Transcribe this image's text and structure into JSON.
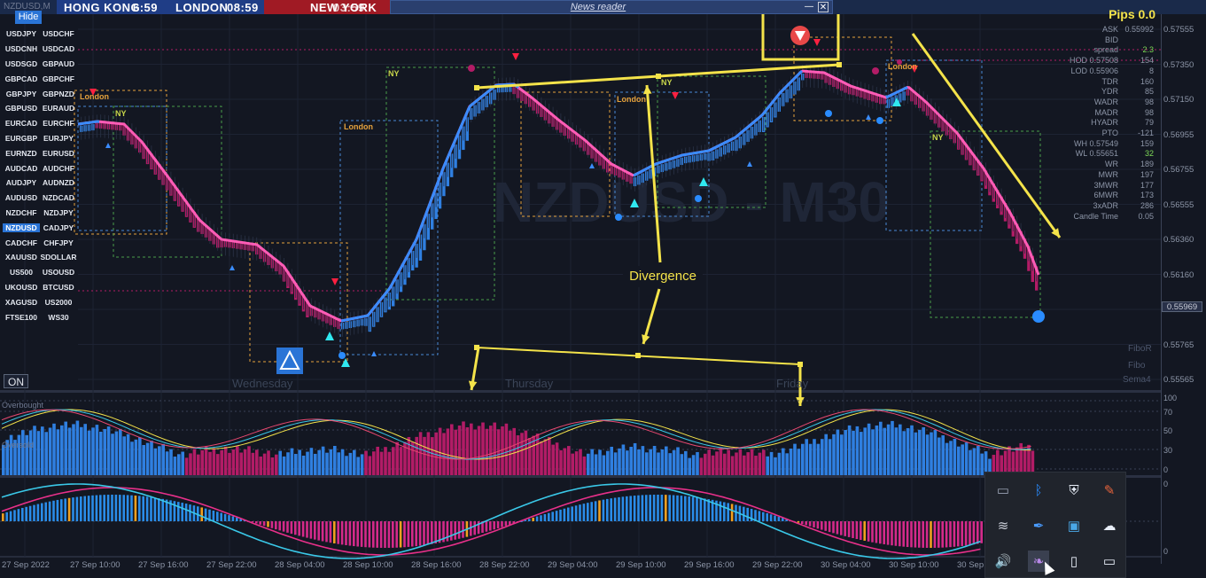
{
  "window": {
    "symbol_title": "NZDUSD,M",
    "hide_label": "Hide",
    "news_label": "News reader",
    "on_label": "ON",
    "watermark": "NZDUSD - M30"
  },
  "clocks": [
    {
      "label": "HONG KONG",
      "time": "6:59"
    },
    {
      "label": "LONDON",
      "time": "08:59"
    },
    {
      "label": "NEW YORK",
      "time": "03:59"
    }
  ],
  "symbols": [
    [
      "USDJPY",
      "USDCHF"
    ],
    [
      "USDCNH",
      "USDCAD"
    ],
    [
      "USDSGD",
      "GBPAUD"
    ],
    [
      "GBPCAD",
      "GBPCHF"
    ],
    [
      "GBPJPY",
      "GBPNZD"
    ],
    [
      "GBPUSD",
      "EURAUD"
    ],
    [
      "EURCAD",
      "EURCHF"
    ],
    [
      "EURGBP",
      "EURJPY"
    ],
    [
      "EURNZD",
      "EURUSD"
    ],
    [
      "AUDCAD",
      "AUDCHF"
    ],
    [
      "AUDJPY",
      "AUDNZD"
    ],
    [
      "AUDUSD",
      "NZDCAD"
    ],
    [
      "NZDCHF",
      "NZDJPY"
    ],
    [
      "NZDUSD",
      "CADJPY"
    ],
    [
      "CADCHF",
      "CHFJPY"
    ],
    [
      "XAUUSD",
      "SDOLLAR"
    ],
    [
      "US500",
      "USOUSD"
    ],
    [
      "UKOUSD",
      "BTCUSD"
    ],
    [
      "XAGUSD",
      "US2000"
    ],
    [
      "FTSE100",
      "WS30"
    ]
  ],
  "active_symbol": "NZDUSD",
  "stats": {
    "pips_title": "Pips 0.0",
    "rows": [
      {
        "label": "ASK",
        "value": "0.55992",
        "color": "#8d96a8"
      },
      {
        "label": "BID",
        "value": "",
        "color": "#8d96a8"
      },
      {
        "label": "spread",
        "value": "2.3",
        "color": "#7ed957"
      },
      {
        "label": "HOD 0.57508",
        "value": "154",
        "color": "#8d96a8"
      },
      {
        "label": "LOD 0.55906",
        "value": "8",
        "color": "#8d96a8"
      },
      {
        "label": "TDR",
        "value": "160",
        "color": "#8d96a8"
      },
      {
        "label": "YDR",
        "value": "85",
        "color": "#8d96a8"
      },
      {
        "label": "WADR",
        "value": "98",
        "color": "#8d96a8"
      },
      {
        "label": "MADR",
        "value": "98",
        "color": "#8d96a8"
      },
      {
        "label": "HYADR",
        "value": "79",
        "color": "#8d96a8"
      },
      {
        "label": "PTO",
        "value": "-121",
        "color": "#8d96a8"
      },
      {
        "label": "WH 0.57549",
        "value": "159",
        "color": "#8d96a8"
      },
      {
        "label": "WL 0.55651",
        "value": "32",
        "color": "#7ed957"
      },
      {
        "label": "WR",
        "value": "189",
        "color": "#8d96a8"
      },
      {
        "label": "MWR",
        "value": "197",
        "color": "#8d96a8"
      },
      {
        "label": "3MWR",
        "value": "177",
        "color": "#8d96a8"
      },
      {
        "label": "6MWR",
        "value": "173",
        "color": "#8d96a8"
      },
      {
        "label": "3xADR",
        "value": "286",
        "color": "#8d96a8"
      },
      {
        "label": "Candle Time",
        "value": "0.05",
        "color": "#8d96a8"
      }
    ]
  },
  "price_axis": {
    "ticks": [
      "0.57555",
      "0.57350",
      "0.57150",
      "0.56955",
      "0.56755",
      "0.56555",
      "0.56360",
      "0.56160",
      "0.55969",
      "0.55765",
      "0.55565"
    ],
    "current": "0.55969"
  },
  "right_labels": {
    "fibor": "FiboR",
    "fibo": "Fibo",
    "sema": "Sema4"
  },
  "days": [
    "Wednesday",
    "Thursday",
    "Friday"
  ],
  "time_axis": [
    "27 Sep 2022",
    "27 Sep 10:00",
    "27 Sep 16:00",
    "27 Sep 22:00",
    "28 Sep 04:00",
    "28 Sep 10:00",
    "28 Sep 16:00",
    "28 Sep 22:00",
    "29 Sep 04:00",
    "29 Sep 10:00",
    "29 Sep 16:00",
    "29 Sep 22:00",
    "30 Sep 04:00",
    "30 Sep 10:00",
    "30 Sep"
  ],
  "oscillator": {
    "overbought": "Overbought",
    "oversold": "Oversold",
    "ticks": [
      "100",
      "70",
      "50",
      "30",
      "0"
    ]
  },
  "macd": {
    "ticks": [
      "0",
      "0"
    ]
  },
  "sessions": {
    "ny": "NY",
    "london": "London"
  },
  "annotation": "Divergence",
  "colors": {
    "bull": "#2f7fe0",
    "bear": "#b21c66",
    "ma": "#ff5cb6",
    "annot": "#f4e34a",
    "bg": "#131722"
  },
  "tray_icons": [
    "monitor-icon",
    "bluetooth-icon",
    "security-shield-icon",
    "edit-paint-icon",
    "wifi-icon",
    "network-pen-icon",
    "display-settings-icon",
    "cloud-icon",
    "speaker-icon",
    "feather-icon",
    "usb-drive-icon",
    "battery-icon"
  ]
}
